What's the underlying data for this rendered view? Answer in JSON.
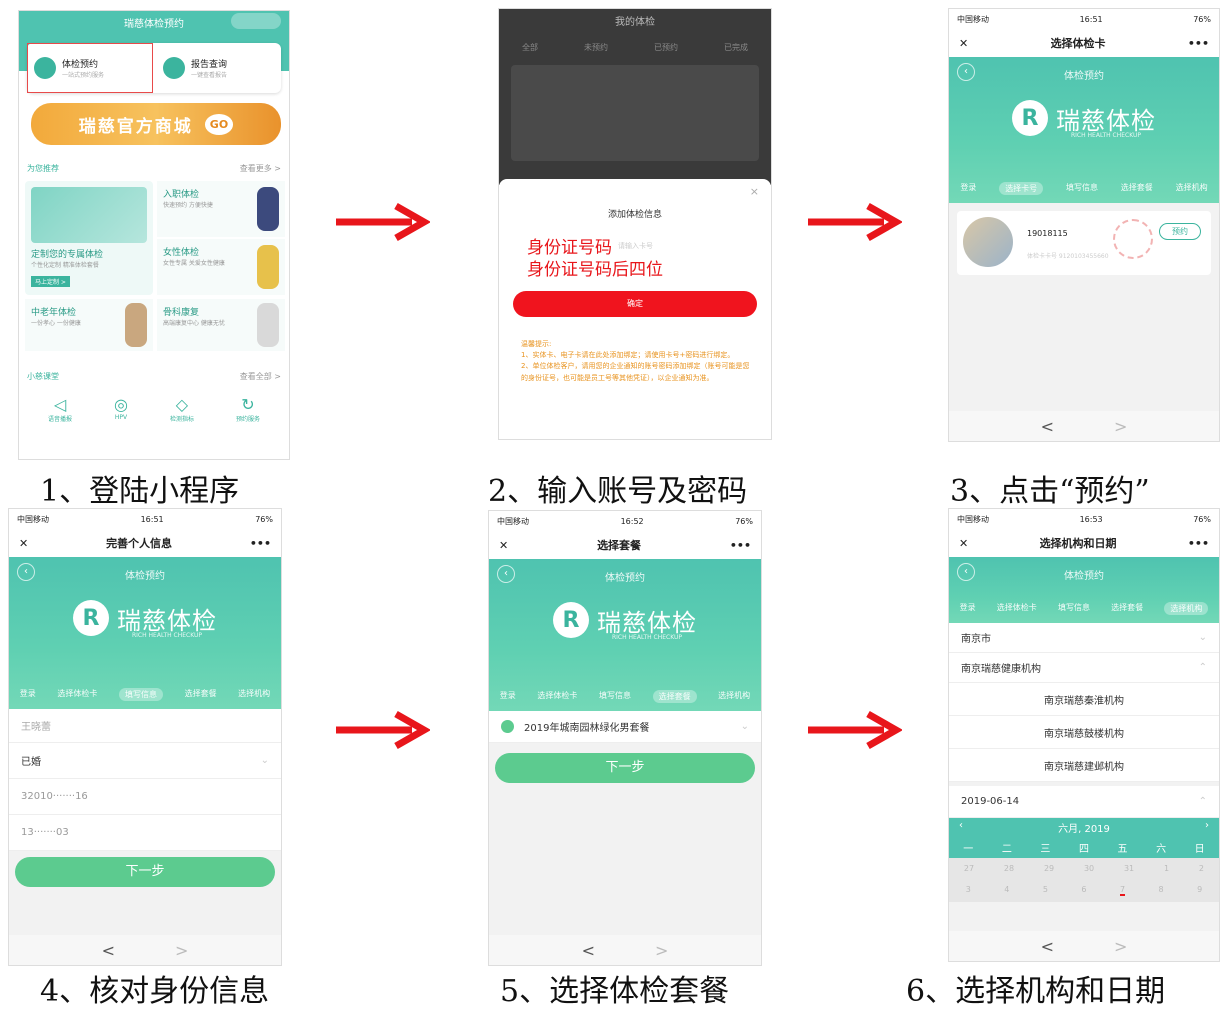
{
  "captions": {
    "step1": "1、登陆小程序",
    "step2": "2、输入账号及密码",
    "step3": "3、点击“预约”",
    "step4": "4、核对身份信息",
    "step5": "5、选择体检套餐",
    "step6": "6、选择机构和日期"
  },
  "colors": {
    "teal": "#4fc3b0",
    "red_arrow": "#e8161b",
    "button_green": "#5ccb8f",
    "red_button": "#f0141e"
  },
  "status": {
    "carrier": "中国移动",
    "battery": "76%"
  },
  "brand": {
    "name": "瑞慈体检",
    "sub": "RICH HEALTH CHECKUP"
  },
  "screen1": {
    "title": "瑞慈体检预约",
    "card_booking": "体检预约",
    "card_booking_sub": "一站式预约服务",
    "card_report": "报告查询",
    "card_report_sub": "一键查看报告",
    "mall_banner": "瑞慈官方商城",
    "mall_badge": "GO",
    "recommend": "为您推荐",
    "see_more": "查看更多 >",
    "custom_pkg": "定制您的专属体检",
    "custom_pkg_sub": "个性化定制 精准体检套餐",
    "custom_btn": "马上定制 >",
    "entry": "入职体检",
    "entry_sub": "快速预约 方便快捷",
    "female": "女性体检",
    "female_sub": "女性专属 关爱女性健康",
    "senior": "中老年体检",
    "senior_sub": "一份孝心 一份健康",
    "rehab": "骨科康复",
    "rehab_sub": "高端康复中心 健康无忧",
    "class": "小慈课堂",
    "see_all": "查看全部 >",
    "icons": [
      "语音播报",
      "HPV",
      "检测指标",
      "预约服务"
    ]
  },
  "screen2": {
    "title": "我的体检",
    "tabs": [
      "全部",
      "未预约",
      "已预约",
      "已完成"
    ],
    "dialog_title": "添加体检信息",
    "field_id": "身份证号码",
    "field_id_placeholder": "请输入卡号",
    "field_pwd": "身份证号码后四位",
    "confirm": "确定",
    "tips_title": "温馨提示:",
    "tip1": "1、实体卡、电子卡请在此处添加绑定；请使用卡号+密码进行绑定。",
    "tip2": "2、单位体检客户，请用您的企业通知的账号密码添加绑定（账号可能是您的身份证号，也可能是员工号等其他凭证），以企业通知为准。"
  },
  "screen3": {
    "time": "16:51",
    "title": "选择体检卡",
    "hero_sub": "体检预约",
    "steps": [
      "登录",
      "选择卡号",
      "填写信息",
      "选择套餐",
      "选择机构"
    ],
    "active_step": 1,
    "card_number": "19018115",
    "card_line": "体检卡卡号 9120103455660",
    "book_btn": "预约"
  },
  "screen4": {
    "time": "16:51",
    "title": "完善个人信息",
    "hero_sub": "体检预约",
    "steps": [
      "登录",
      "选择体检卡",
      "填写信息",
      "选择套餐",
      "选择机构"
    ],
    "active_step": 2,
    "name": "王晓蕾",
    "marital": "已婚",
    "id_number": "32010·······16",
    "phone": "13·······03",
    "next": "下一步"
  },
  "screen5": {
    "time": "16:52",
    "title": "选择套餐",
    "hero_sub": "体检预约",
    "steps": [
      "登录",
      "选择体检卡",
      "填写信息",
      "选择套餐",
      "选择机构"
    ],
    "active_step": 3,
    "package": "2019年城南园林绿化男套餐",
    "next": "下一步"
  },
  "screen6": {
    "time": "16:53",
    "title": "选择机构和日期",
    "hero_sub": "体检预约",
    "steps": [
      "登录",
      "选择体检卡",
      "填写信息",
      "选择套餐",
      "选择机构"
    ],
    "active_step": 4,
    "city": "南京市",
    "group": "南京瑞慈健康机构",
    "branches": [
      "南京瑞慈秦淮机构",
      "南京瑞慈鼓楼机构",
      "南京瑞慈建邺机构"
    ],
    "date": "2019-06-14",
    "month": "六月, 2019",
    "weekdays": [
      "一",
      "二",
      "三",
      "四",
      "五",
      "六",
      "日"
    ],
    "week1": [
      "27",
      "28",
      "29",
      "30",
      "31",
      "1",
      "2"
    ],
    "week2": [
      "3",
      "4",
      "5",
      "6",
      "7",
      "8",
      "9"
    ]
  },
  "nav": {
    "back": "<",
    "forward": ">"
  }
}
